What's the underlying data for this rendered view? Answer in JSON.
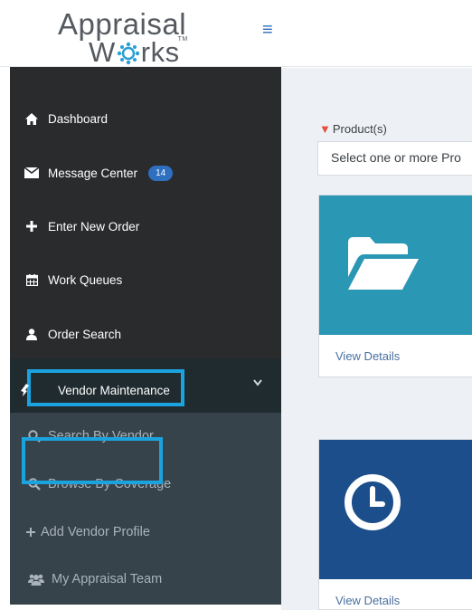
{
  "header": {
    "logo_line1": "Appraisal",
    "logo_line2_a": "W",
    "logo_line2_b": "rks",
    "logo_tm": "TM",
    "menu_icon": "hamburger-icon"
  },
  "sidebar": {
    "items": [
      {
        "label": "Dashboard",
        "icon": "home-icon"
      },
      {
        "label": "Message Center",
        "icon": "envelope-icon",
        "badge": "14"
      },
      {
        "label": "Enter New Order",
        "icon": "plus-icon"
      },
      {
        "label": "Work Queues",
        "icon": "calendar-icon"
      },
      {
        "label": "Order Search",
        "icon": "user-icon"
      }
    ],
    "vendor": {
      "label": "Vendor Maintenance",
      "icon": "wrench-icon",
      "expanded": true
    },
    "submenu": [
      {
        "label": "Search By Vendor",
        "icon": "search-icon"
      },
      {
        "label": "Browse By Coverage",
        "icon": "search-icon"
      },
      {
        "label": "Add Vendor Profile",
        "icon": "plus-icon"
      },
      {
        "label": "My Appraisal Team",
        "icon": "users-icon"
      }
    ]
  },
  "main": {
    "filter_label": "Product(s)",
    "filter_placeholder": "Select one or more Pro",
    "cards": [
      {
        "icon": "folder-open-icon",
        "link": "View Details"
      },
      {
        "icon": "clock-icon",
        "link": "View Details"
      }
    ]
  },
  "colors": {
    "sidebar_bg": "#2a2b2d",
    "submenu_bg": "#36434a",
    "highlight_border": "#1ba3df",
    "card1": "#2a97b5",
    "card2": "#1b4e8a",
    "badge": "#2f6fc0"
  }
}
